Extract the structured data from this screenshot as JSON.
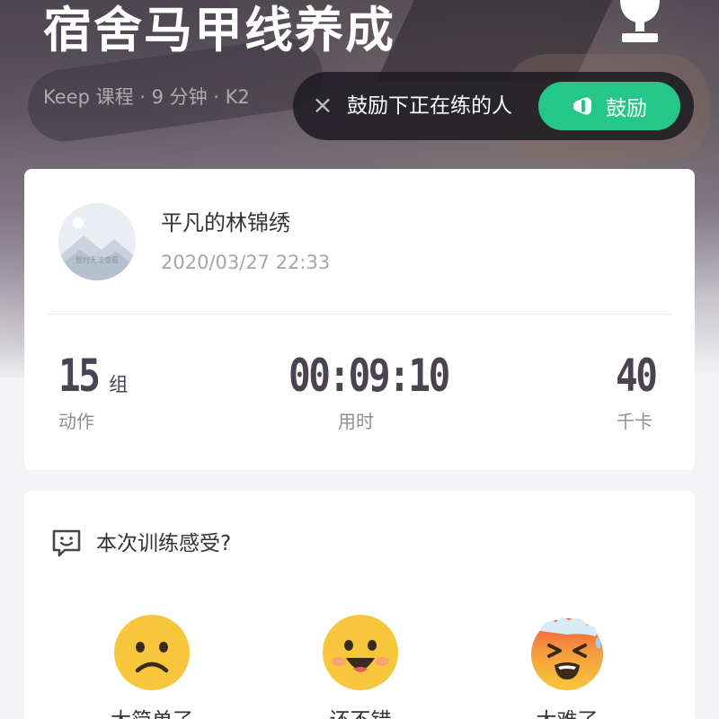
{
  "header": {
    "title": "宿舍马甲线养成",
    "subtitle": "Keep 课程 · 9 分钟 · K2"
  },
  "cheer": {
    "text": "鼓励下正在练的人",
    "button_label": "鼓励",
    "close_symbol": "×",
    "accent": "#24c789"
  },
  "user": {
    "name": "平凡的林锦绣",
    "time": "2020/03/27 22:33",
    "avatar_placeholder": "暂时无法查看"
  },
  "stats": [
    {
      "value": "15",
      "unit": "组",
      "label": "动作"
    },
    {
      "value": "00:09:10",
      "unit": "",
      "label": "用时"
    },
    {
      "value": "40",
      "unit": "",
      "label": "千卡"
    }
  ],
  "feeling": {
    "title": "本次训练感受?",
    "options": [
      {
        "label": "太简单了",
        "icon": "frown-emoji-icon"
      },
      {
        "label": "还不错",
        "icon": "happy-emoji-icon"
      },
      {
        "label": "太难了",
        "icon": "sweating-emoji-icon"
      }
    ]
  }
}
